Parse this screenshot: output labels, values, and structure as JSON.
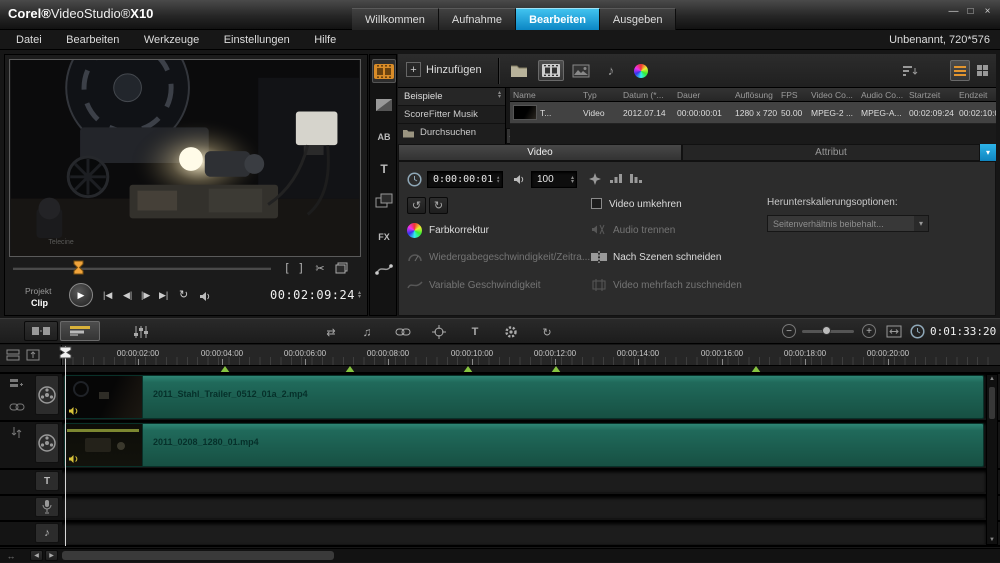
{
  "colors": {
    "accent_blue": "#1ba7dd",
    "clip_teal": "#1f6b5d",
    "marker_green": "#86c440",
    "nav_orange": "#e2952f"
  },
  "icons": {
    "minimize": "—",
    "maximize": "□",
    "close": "×",
    "play": "▶",
    "go_start": "|◀",
    "prev_frame": "◀|",
    "next_frame": "|▶",
    "go_end": "▶|",
    "repeat": "↻",
    "mark_in": "[",
    "mark_out": "]",
    "scissors": "✂",
    "rotate_left": "↺",
    "rotate_right": "↻",
    "spinner_up": "▴",
    "spinner_down": "▾",
    "dropdown": "▾",
    "collapse": "◀",
    "scroll_left": "◀",
    "scroll_right": "▶",
    "scroll_up": "▲",
    "scroll_down": "▼",
    "zoom_out": "−",
    "zoom_in": "+",
    "note": "♪",
    "music": "♫",
    "pan": "↔",
    "ripple": "⇄",
    "chapter": "◆",
    "loop": "↻",
    "ab": "AB",
    "title_t": "T",
    "fx": "FX",
    "subtitle_t": "T"
  },
  "title": {
    "brand_corel": "Corel®",
    "brand_product": "VideoStudio®",
    "brand_version": "X10",
    "tabs": [
      "Willkommen",
      "Aufnahme",
      "Bearbeiten",
      "Ausgeben"
    ]
  },
  "menu": {
    "items": [
      "Datei",
      "Bearbeiten",
      "Werkzeuge",
      "Einstellungen",
      "Hilfe"
    ],
    "project": "Unbenannt, 720*576"
  },
  "preview": {
    "watermark": "Telecine",
    "project_label": "Projekt",
    "clip_label": "Clip",
    "timecode": "00:02:09:24"
  },
  "library": {
    "add_label": "Hinzufügen",
    "tree": [
      "Beispiele",
      "ScoreFitter Musik",
      "Durchsuchen"
    ],
    "columns": [
      "Name",
      "Typ",
      "Datum (*...",
      "Dauer",
      "Auflösung",
      "FPS",
      "Video Co...",
      "Audio Co...",
      "Startzeit",
      "Endzeit"
    ],
    "row": [
      "T...",
      "Video",
      "2012.07.14",
      "00:00:00:01",
      "1280 x 720",
      "50.00",
      "MPEG-2 ...",
      "MPEG-A...",
      "00:02:09:24",
      "00:02:10:0..."
    ]
  },
  "options": {
    "tab_video": "Video",
    "tab_attribut": "Attribut",
    "duration": "0:00:00:01",
    "volume": "100",
    "color_correction": "Farbkorrektur",
    "playback_speed": "Wiedergabegeschwindigkeit/Zeitra...",
    "variable_speed": "Variable Geschwindigkeit",
    "reverse_video": "Video umkehren",
    "split_audio": "Audio trennen",
    "split_by_scene": "Nach Szenen schneiden",
    "multi_trim": "Video mehrfach zuschneiden",
    "downscale_label": "Herunterskalierungsoptionen:",
    "downscale_value": "Seitenverhältnis beibehalt..."
  },
  "timeline": {
    "timecode": "0:01:33:20",
    "ruler": [
      "00:00:02:00",
      "00:00:04:00",
      "00:00:06:00",
      "00:00:08:00",
      "00:00:10:00",
      "00:00:12:00",
      "00:00:14:00",
      "00:00:16:00",
      "00:00:18:00",
      "00:00:20:00"
    ],
    "clips": [
      {
        "name": "2011_Stahl_Trailer_0512_01a_2.mp4"
      },
      {
        "name": "2011_0208_1280_01.mp4"
      }
    ]
  }
}
